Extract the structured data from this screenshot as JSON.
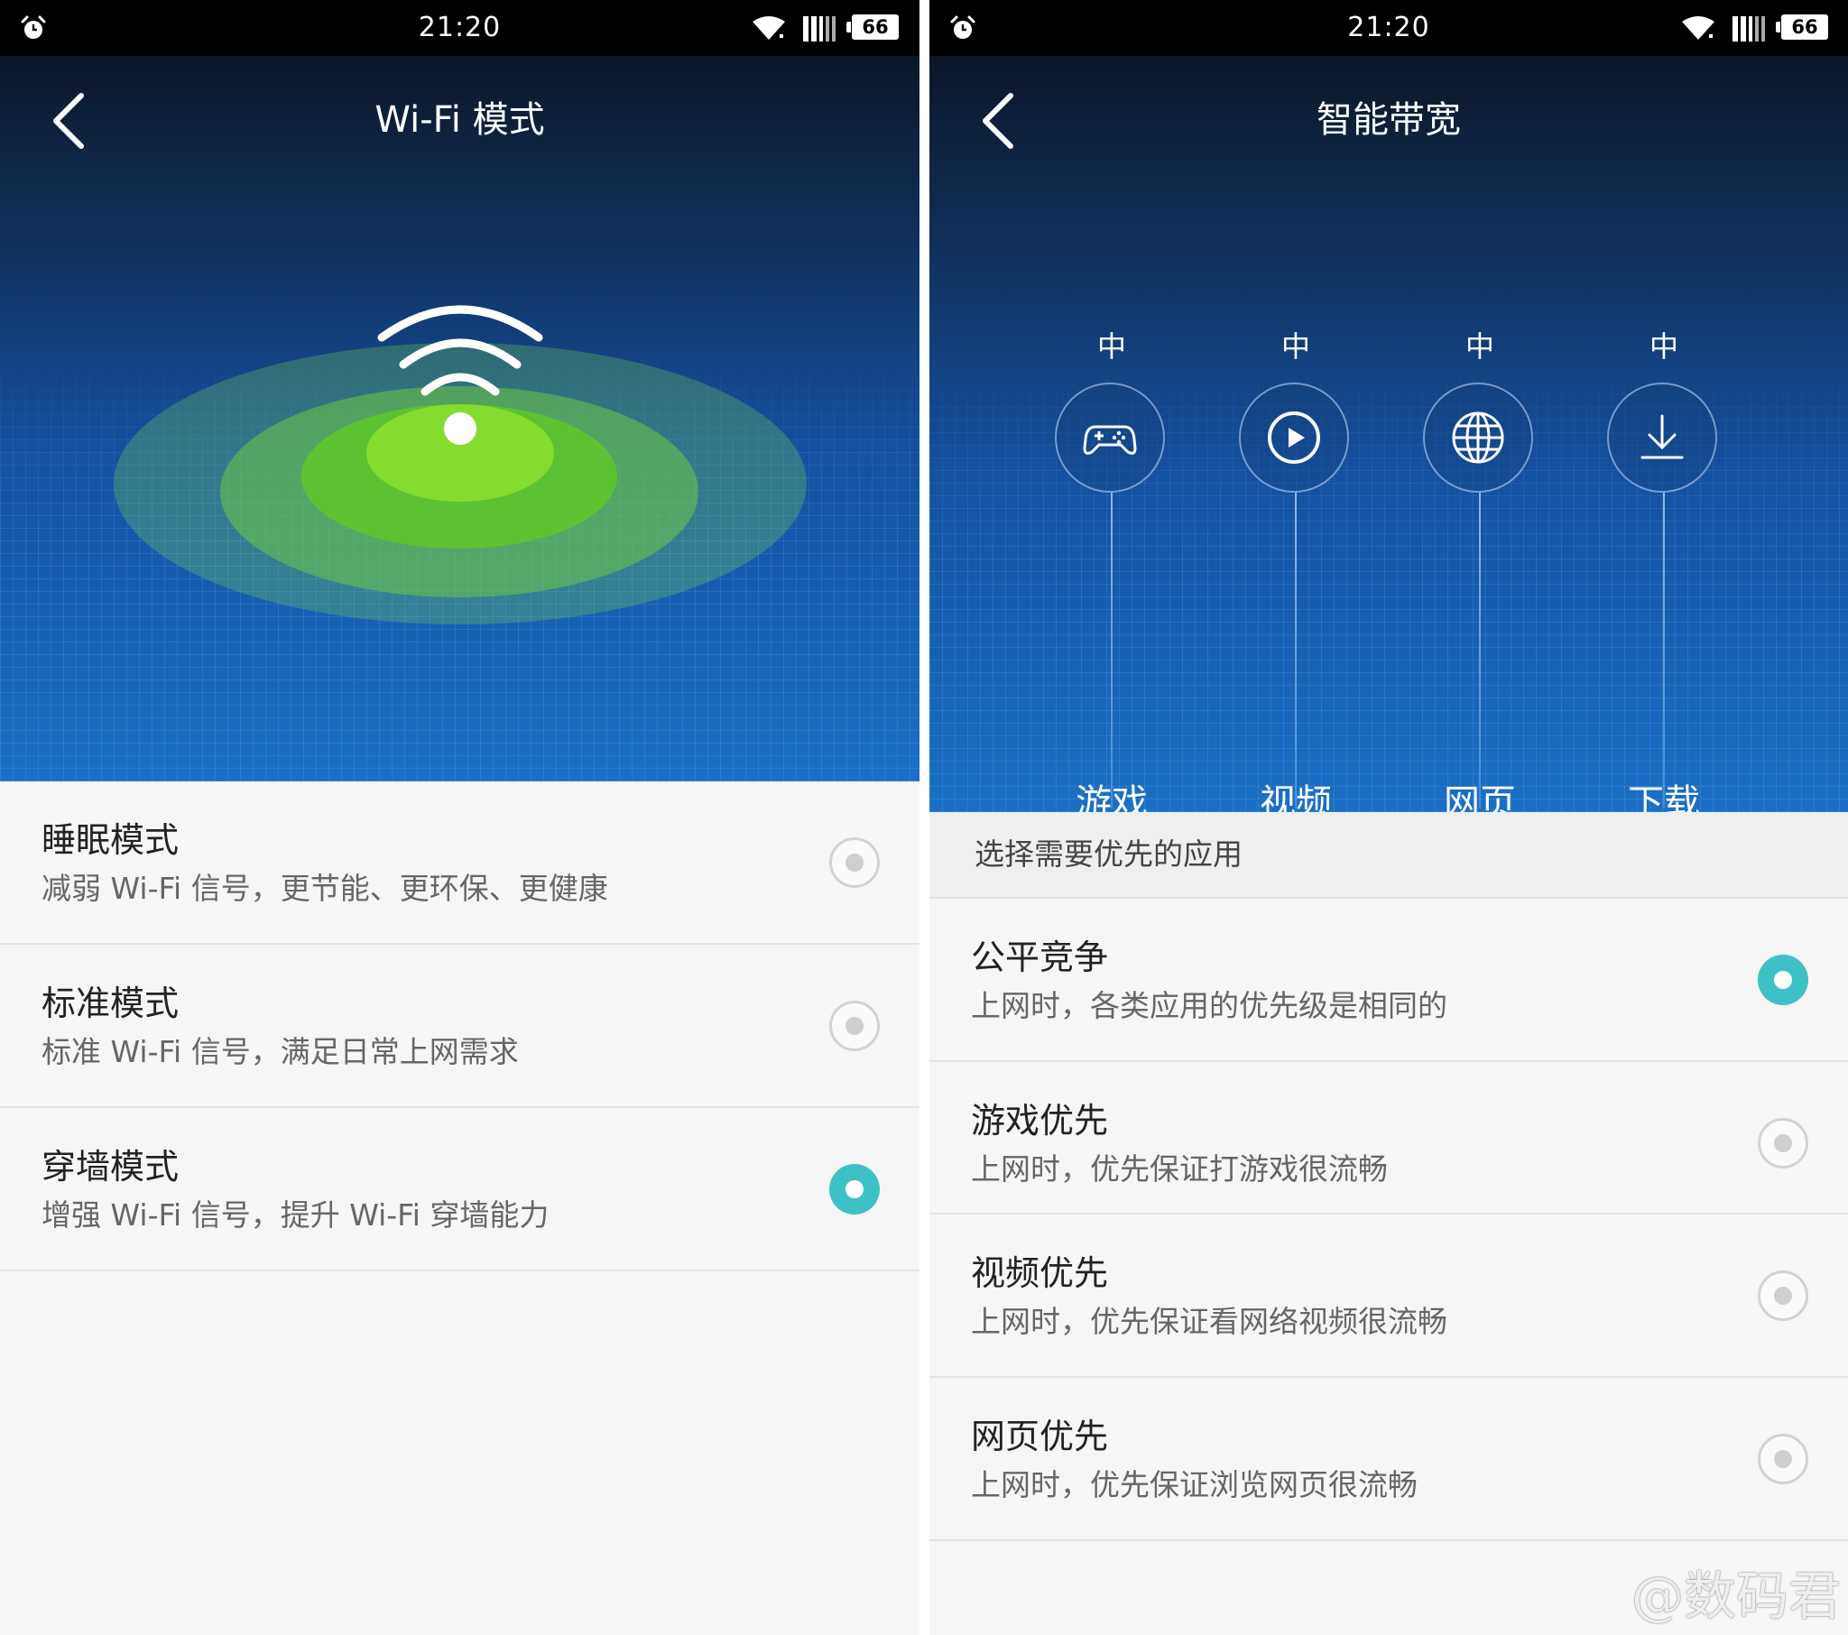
{
  "left_screen": {
    "status": {
      "time": "21:20",
      "battery": "66"
    },
    "title": "Wi-Fi 模式",
    "modes": [
      {
        "title": "睡眠模式",
        "desc": "减弱 Wi-Fi 信号，更节能、更环保、更健康",
        "selected": false
      },
      {
        "title": "标准模式",
        "desc": "标准 Wi-Fi 信号，满足日常上网需求",
        "selected": false
      },
      {
        "title": "穿墙模式",
        "desc": "增强 Wi-Fi 信号，提升 Wi-Fi 穿墙能力",
        "selected": true
      }
    ]
  },
  "right_screen": {
    "status": {
      "time": "21:20",
      "battery": "66"
    },
    "title": "智能带宽",
    "bandwidth": [
      {
        "level": "中",
        "label": "游戏",
        "icon": "gamepad-icon"
      },
      {
        "level": "中",
        "label": "视频",
        "icon": "play-icon"
      },
      {
        "level": "中",
        "label": "网页",
        "icon": "globe-icon"
      },
      {
        "level": "中",
        "label": "下载",
        "icon": "download-icon"
      }
    ],
    "section_header": "选择需要优先的应用",
    "options": [
      {
        "title": "公平竞争",
        "desc": "上网时，各类应用的优先级是相同的",
        "selected": true
      },
      {
        "title": "游戏优先",
        "desc": "上网时，优先保证打游戏很流畅",
        "selected": false
      },
      {
        "title": "视频优先",
        "desc": "上网时，优先保证看网络视频很流畅",
        "selected": false
      },
      {
        "title": "网页优先",
        "desc": "上网时，优先保证浏览网页很流畅",
        "selected": false
      }
    ]
  },
  "watermark": "@数码君",
  "colors": {
    "accent": "#3ec1c6",
    "hero_green": "#7fd92e",
    "status_bar": "#000000"
  }
}
